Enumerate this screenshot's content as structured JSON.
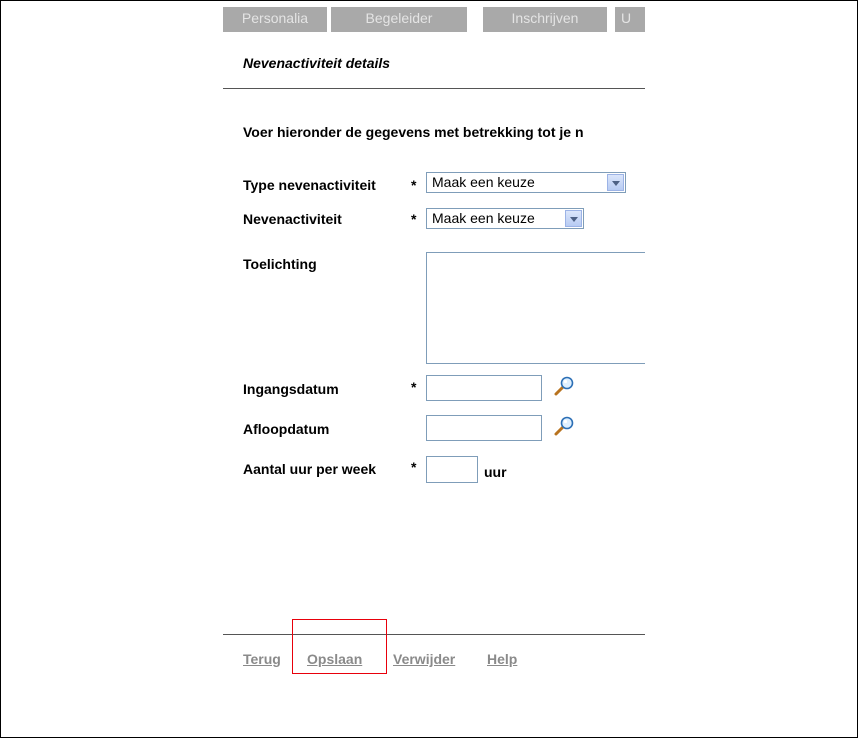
{
  "tabs": [
    {
      "label": "Personalia"
    },
    {
      "label": "Begeleider"
    },
    {
      "label": "Inschrijven"
    },
    {
      "label": "U"
    }
  ],
  "section_title": "Nevenactiviteit details",
  "intro_text": "Voer hieronder de gegevens met betrekking tot je n",
  "form": {
    "required_marker": "*",
    "type_label": "Type nevenactiviteit",
    "type_value": "Maak een keuze",
    "activity_label": "Nevenactiviteit",
    "activity_value": "Maak een keuze",
    "note_label": "Toelichting",
    "note_value": "",
    "start_label": "Ingangsdatum",
    "start_value": "",
    "end_label": "Afloopdatum",
    "end_value": "",
    "hours_label": "Aantal uur per week",
    "hours_value": "",
    "hours_unit": "uur"
  },
  "actions": {
    "back": "Terug",
    "save": "Opslaan",
    "delete": "Verwijder",
    "help": "Help"
  },
  "colors": {
    "tab_bg": "#a9a9a9",
    "link": "#8a8a8a",
    "highlight": "#e8000b",
    "field_border": "#7f9db9"
  }
}
